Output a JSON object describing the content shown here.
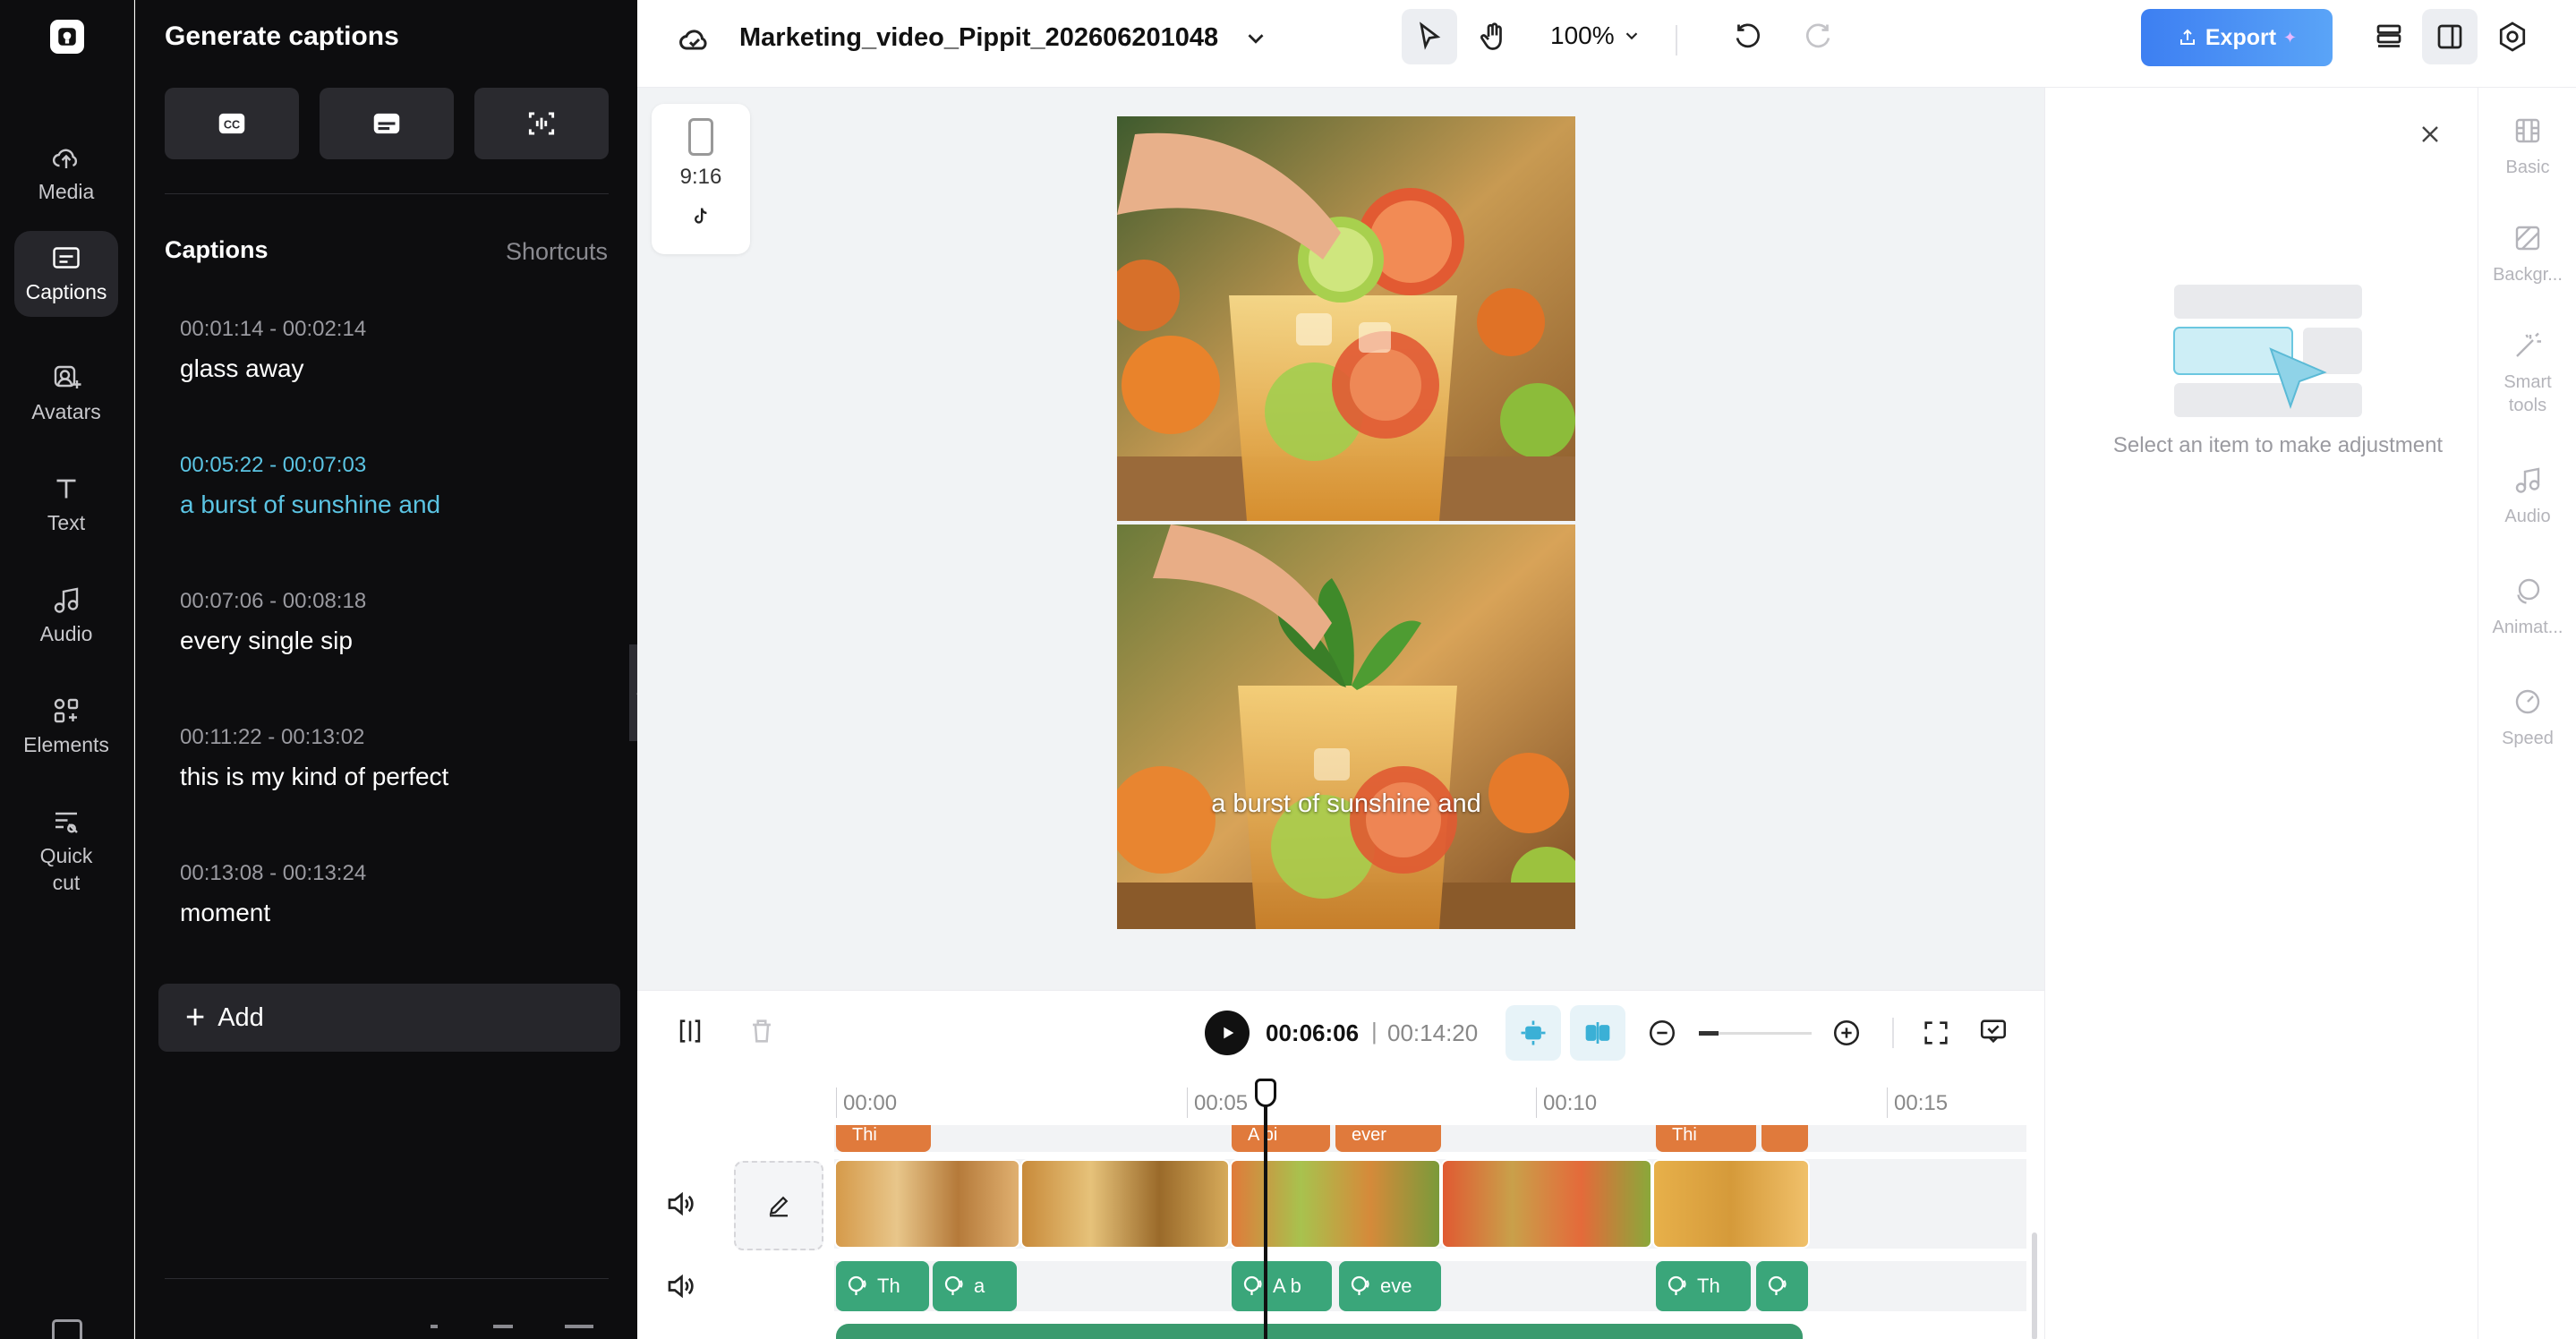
{
  "colors": {
    "accent": "#5bc4e3",
    "export_gradient_start": "#3d7ff2",
    "caption_track": "#e07a3c",
    "audio_track": "#3aa67a"
  },
  "nav": {
    "items": [
      {
        "label": "Media",
        "icon": "cloud-upload-icon"
      },
      {
        "label": "Captions",
        "icon": "captions-icon",
        "active": true
      },
      {
        "label": "Avatars",
        "icon": "avatar-icon"
      },
      {
        "label": "Text",
        "icon": "text-icon"
      },
      {
        "label": "Audio",
        "icon": "music-note-icon"
      },
      {
        "label": "Elements",
        "icon": "elements-icon"
      },
      {
        "label": "Quick\ncut",
        "icon": "quick-cut-icon"
      }
    ]
  },
  "panel": {
    "title": "Generate captions",
    "generate_buttons": [
      "cc-icon",
      "subtitle-icon",
      "audio-caption-icon"
    ],
    "captions_heading": "Captions",
    "shortcuts_label": "Shortcuts",
    "captions": [
      {
        "time": "00:01:14 - 00:02:14",
        "text": "glass away",
        "active": false
      },
      {
        "time": "00:05:22 - 00:07:03",
        "text": "a burst of sunshine and",
        "active": true
      },
      {
        "time": "00:07:06 - 00:08:18",
        "text": "every single sip",
        "active": false
      },
      {
        "time": "00:11:22 - 00:13:02",
        "text": "this is my kind of perfect",
        "active": false
      },
      {
        "time": "00:13:08 - 00:13:24",
        "text": "moment",
        "active": false
      }
    ],
    "add_label": "Add"
  },
  "topbar": {
    "project_title": "Marketing_video_Pippit_202606201048",
    "zoom": "100%",
    "export_label": "Export"
  },
  "canvas": {
    "aspect_ratio": "9:16",
    "subtitle": "a burst of sunshine and"
  },
  "adjust": {
    "message": "Select an item to make adjustment"
  },
  "properties": [
    {
      "label": "Basic",
      "icon": "basic-icon"
    },
    {
      "label": "Backgr...",
      "icon": "background-icon"
    },
    {
      "label": "Smart tools",
      "icon": "magic-wand-icon"
    },
    {
      "label": "Audio",
      "icon": "music-note-icon"
    },
    {
      "label": "Animat...",
      "icon": "animation-icon"
    },
    {
      "label": "Speed",
      "icon": "speed-icon"
    }
  ],
  "timeline": {
    "current_time": "00:06:06",
    "separator": "|",
    "total_time": "00:14:20",
    "ruler": [
      "00:00",
      "00:05",
      "00:10",
      "00:15"
    ],
    "caption_clips": [
      "Thi",
      "A bi",
      "ever",
      "Thi",
      ""
    ],
    "audio_clips": [
      "Th",
      "a",
      "A b",
      "eve",
      "Th",
      ""
    ]
  }
}
